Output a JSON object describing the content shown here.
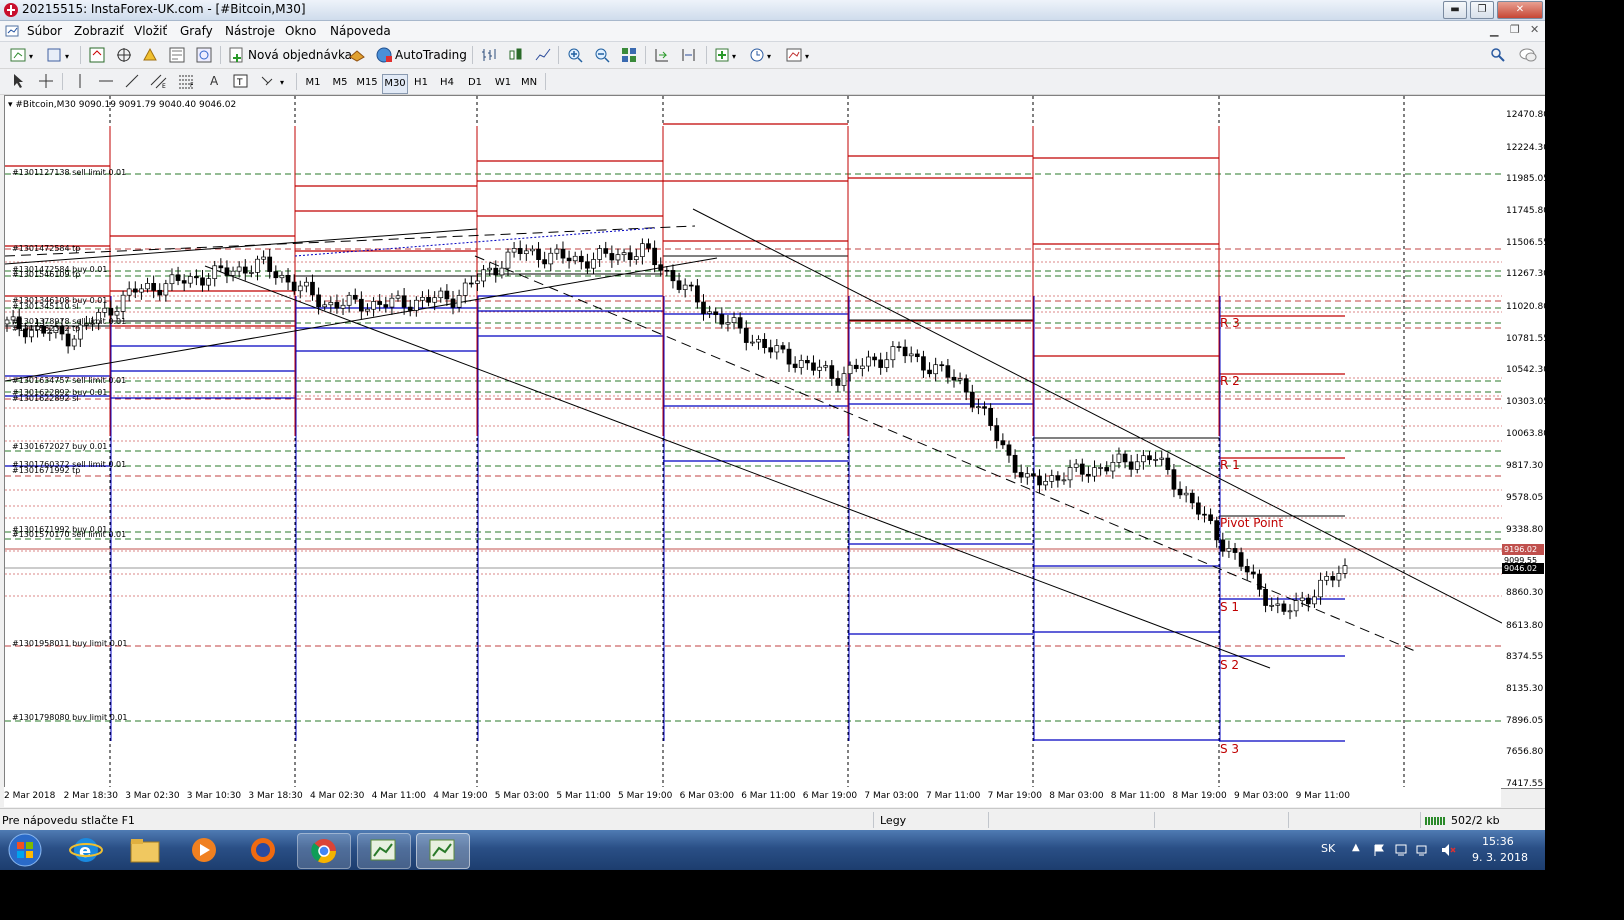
{
  "window": {
    "title": "20215515: InstaForex-UK.com - [#Bitcoin,M30]",
    "min_label": "▬",
    "max_label": "❐",
    "close_label": "✕"
  },
  "menu": [
    "Súbor",
    "Zobraziť",
    "Vložiť",
    "Grafy",
    "Nástroje",
    "Okno",
    "Nápoveda"
  ],
  "toolbar": {
    "new_order_label": "Nová objednávka",
    "autotrading_label": "AutoTrading",
    "timeframes": [
      "M1",
      "M5",
      "M15",
      "M30",
      "H1",
      "H4",
      "D1",
      "W1",
      "MN"
    ],
    "active_timeframe": "M30"
  },
  "chart": {
    "header": "#Bitcoin,M30  9090.19 9091.79 9040.40 9046.02",
    "price_ticks": [
      "12470.80",
      "12224.30",
      "11985.05",
      "11745.80",
      "11506.55",
      "11267.30",
      "11020.80",
      "10781.55",
      "10542.30",
      "10303.05",
      "10063.80",
      "9817.30",
      "9578.05",
      "9338.80",
      "9099.55",
      "8860.30",
      "8613.80",
      "8374.55",
      "8135.30",
      "7896.05",
      "7656.80",
      "7417.55"
    ],
    "time_ticks": [
      "2 Mar 2018",
      "2 Mar 18:30",
      "3 Mar 02:30",
      "3 Mar 10:30",
      "3 Mar 18:30",
      "4 Mar 02:30",
      "4 Mar 11:00",
      "4 Mar 19:00",
      "5 Mar 03:00",
      "5 Mar 11:00",
      "5 Mar 19:00",
      "6 Mar 03:00",
      "6 Mar 11:00",
      "6 Mar 19:00",
      "7 Mar 03:00",
      "7 Mar 11:00",
      "7 Mar 19:00",
      "8 Mar 03:00",
      "8 Mar 11:00",
      "8 Mar 19:00",
      "9 Mar 03:00",
      "9 Mar 11:00"
    ],
    "order_labels": [
      "#1301127138 sell limit 0.01",
      "#1301472584 tp",
      "#1301472584 buy 0.01",
      "#1301546109 tp",
      "#1301346108 buy 0.01",
      "#1301345110 sl",
      "#1301378978 sell limit 0.01",
      "#1301562362 tp",
      "#1301634757 sell limit 0.01",
      "#1301622892 buy 0.01",
      "#1301622892 sl",
      "#1301672027 buy 0.01",
      "#1301760372 sell limit 0.01",
      "#1301671992 tp",
      "#1301671992 buy 0.01",
      "#1301570170 sell limit 0.01",
      "#1301958011 buy limit 0.01",
      "#1301798080 buy limit 0.01"
    ],
    "pivot_labels": [
      "R 3",
      "R 2",
      "R 1",
      "Pivot Point",
      "S 1",
      "S 2",
      "S 3"
    ],
    "price_tags": {
      "ask": "9196.02",
      "bid": "9046.02",
      "level": "9099.55"
    },
    "colors": {
      "resistance": "#c00000",
      "support": "#0000c0",
      "ask_line": "#c0504d",
      "order_green": "#006000",
      "order_red": "#c00000"
    }
  },
  "status": {
    "help": "Pre nápovedu stlačte F1",
    "profile": "Legy",
    "traffic": "502/2 kb"
  },
  "taskbar": {
    "apps": [
      "start-orb-icon",
      "internet-explorer-icon",
      "file-explorer-icon",
      "media-player-icon",
      "firefox-icon",
      "chrome-icon",
      "metatrader-icon",
      "metatrader-icon"
    ],
    "lang": "SK",
    "time": "15:36",
    "date": "9. 3. 2018"
  },
  "chart_data": {
    "type": "candlestick",
    "title": "#Bitcoin,M30",
    "ohlc_last": {
      "open": 9090.19,
      "high": 9091.79,
      "low": 9040.4,
      "close": 9046.02
    },
    "ylim": [
      7417.55,
      12470.8
    ],
    "x": [
      "2 Mar 2018",
      "2 Mar 18:30",
      "3 Mar 02:30",
      "3 Mar 10:30",
      "3 Mar 18:30",
      "4 Mar 02:30",
      "4 Mar 11:00",
      "4 Mar 19:00",
      "5 Mar 03:00",
      "5 Mar 11:00",
      "5 Mar 19:00",
      "6 Mar 03:00",
      "6 Mar 11:00",
      "6 Mar 19:00",
      "7 Mar 03:00",
      "7 Mar 11:00",
      "7 Mar 19:00",
      "8 Mar 03:00",
      "8 Mar 11:00",
      "8 Mar 19:00",
      "9 Mar 03:00",
      "9 Mar 11:00"
    ],
    "series": [
      {
        "name": "close",
        "values": [
          10900,
          10800,
          11150,
          11250,
          11350,
          11050,
          11050,
          11100,
          11450,
          11380,
          11450,
          11000,
          10700,
          10500,
          10700,
          10450,
          9700,
          9800,
          9900,
          9300,
          8700,
          9050
        ]
      }
    ],
    "pivot_levels": {
      "R 3": 11000,
      "R 2": 10500,
      "R 1": 9800,
      "Pivot Point": 9400,
      "S 1": 8850,
      "S 2": 8350,
      "S 3": 7700
    },
    "grid": false
  }
}
